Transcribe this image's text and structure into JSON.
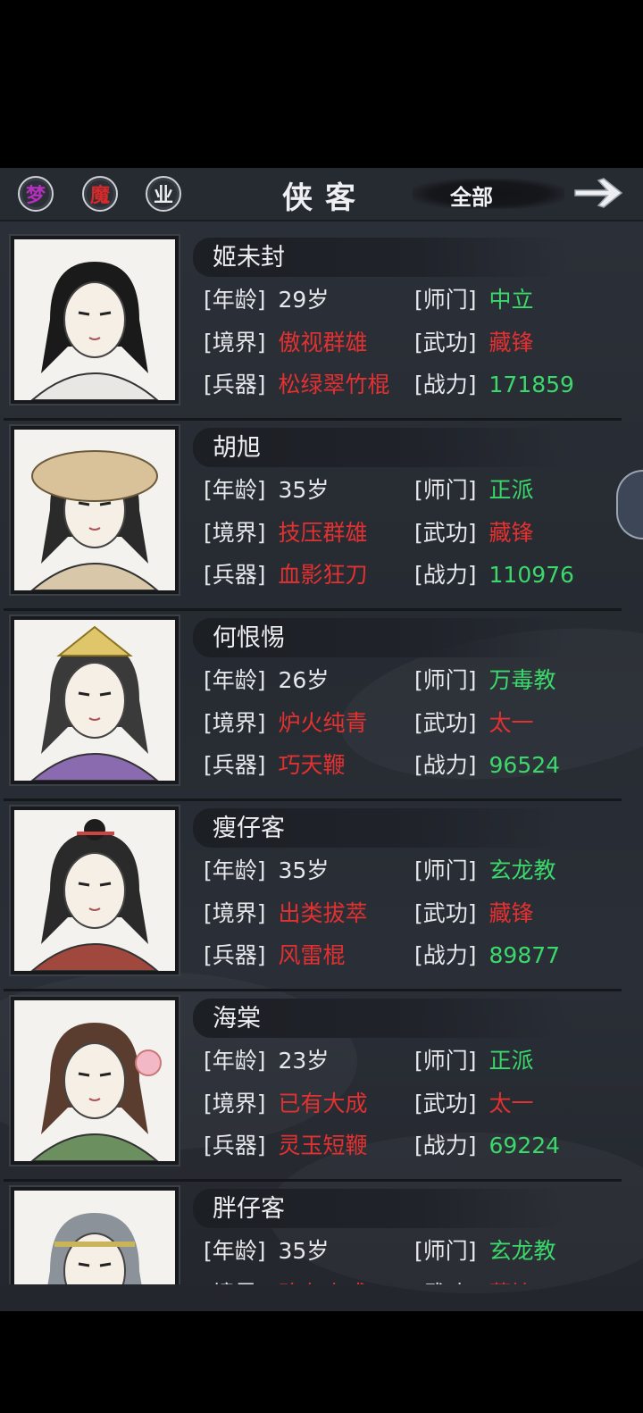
{
  "header": {
    "filter_buttons": [
      {
        "label": "梦",
        "color": "#b62fbf"
      },
      {
        "label": "魔",
        "color": "#d62a2a"
      },
      {
        "label": "业",
        "color": "#eceef1"
      }
    ],
    "title": "侠客",
    "filter_value": "全部",
    "next_icon": "arrow-right-icon"
  },
  "labels": {
    "age": "[年龄]",
    "sect": "[师门]",
    "realm": "[境界]",
    "skill": "[武功]",
    "weapon": "[兵器]",
    "power": "[战力]"
  },
  "heroes": [
    {
      "name": "姬未封",
      "age": "29岁",
      "sect": "中立",
      "realm": "傲视群雄",
      "skill": "藏锋",
      "weapon": "松绿翠竹棍",
      "power": "171859"
    },
    {
      "name": "胡旭",
      "age": "35岁",
      "sect": "正派",
      "realm": "技压群雄",
      "skill": "藏锋",
      "weapon": "血影狂刀",
      "power": "110976"
    },
    {
      "name": "何恨惕",
      "age": "26岁",
      "sect": "万毒教",
      "realm": "炉火纯青",
      "skill": "太一",
      "weapon": "巧天鞭",
      "power": "96524"
    },
    {
      "name": "瘦仔客",
      "age": "35岁",
      "sect": "玄龙教",
      "realm": "出类拔萃",
      "skill": "藏锋",
      "weapon": "风雷棍",
      "power": "89877"
    },
    {
      "name": "海棠",
      "age": "23岁",
      "sect": "正派",
      "realm": "已有大成",
      "skill": "太一",
      "weapon": "灵玉短鞭",
      "power": "69224"
    },
    {
      "name": "胖仔客",
      "age": "35岁",
      "sect": "玄龙教",
      "realm": "略有小成",
      "skill": "藏锋",
      "weapon": "",
      "power": ""
    }
  ],
  "skill_colors": {
    "藏锋": "red",
    "太一": "red"
  },
  "colors": {
    "label": "#e6e8eb",
    "red_value": "#e23131",
    "green_value": "#3bd86b"
  }
}
